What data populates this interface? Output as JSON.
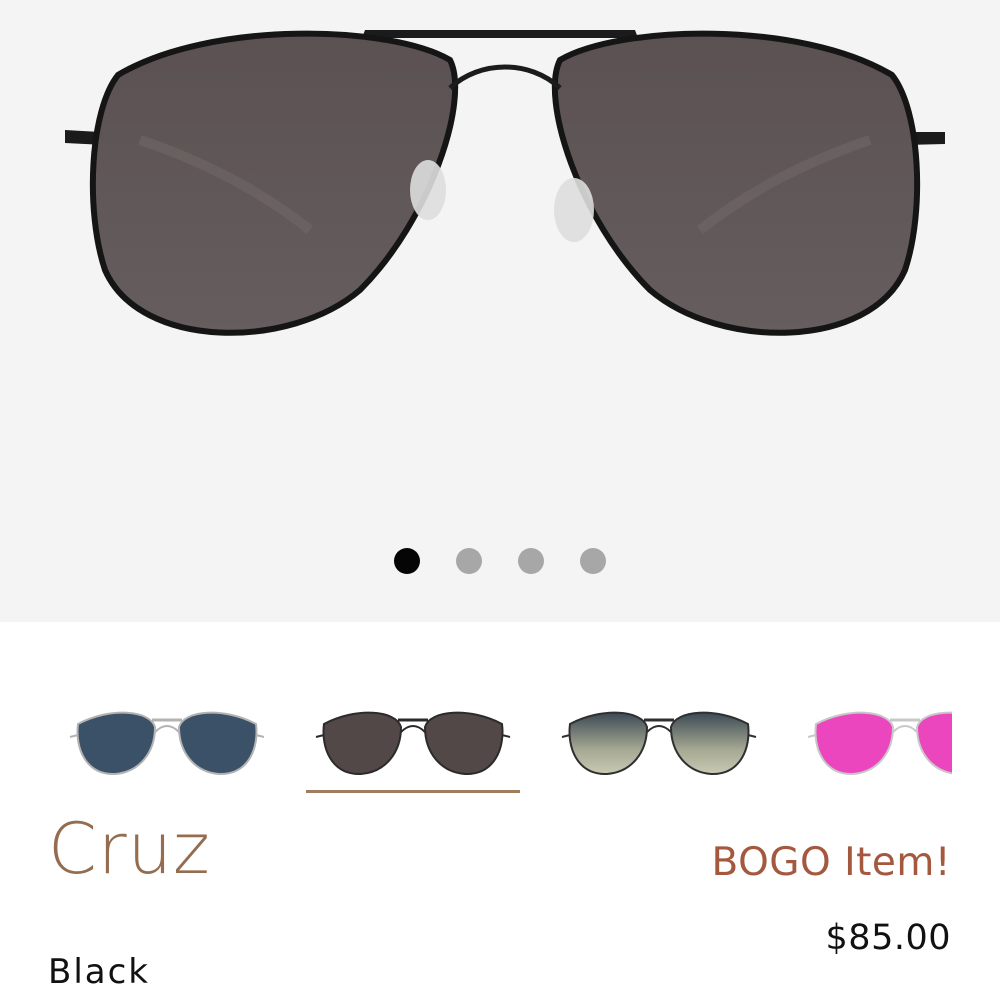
{
  "product": {
    "name": "Cruz",
    "promo": "BOGO Item!",
    "price": "$85.00",
    "color": "Black"
  },
  "gallery": {
    "total_images": 4,
    "active_index": 0
  },
  "variants": [
    {
      "id": "blue",
      "lens": "#3b5168",
      "frame": "#b3b3b3",
      "selected": false
    },
    {
      "id": "black",
      "lens": "#534848",
      "frame": "#2b2b2b",
      "selected": true
    },
    {
      "id": "gradient-green",
      "lens": "#a9aa95",
      "frame": "#2f2f2f",
      "selected": false
    },
    {
      "id": "pink",
      "lens": "#ec46bf",
      "frame": "#c8c8c8",
      "selected": false
    }
  ],
  "colors": {
    "hero_bg": "#f4f4f4",
    "name": "#946d50",
    "promo": "#a4593f",
    "underline": "#9f7d5f",
    "dot_active": "#050505",
    "dot_inactive": "#a7a7a7"
  }
}
